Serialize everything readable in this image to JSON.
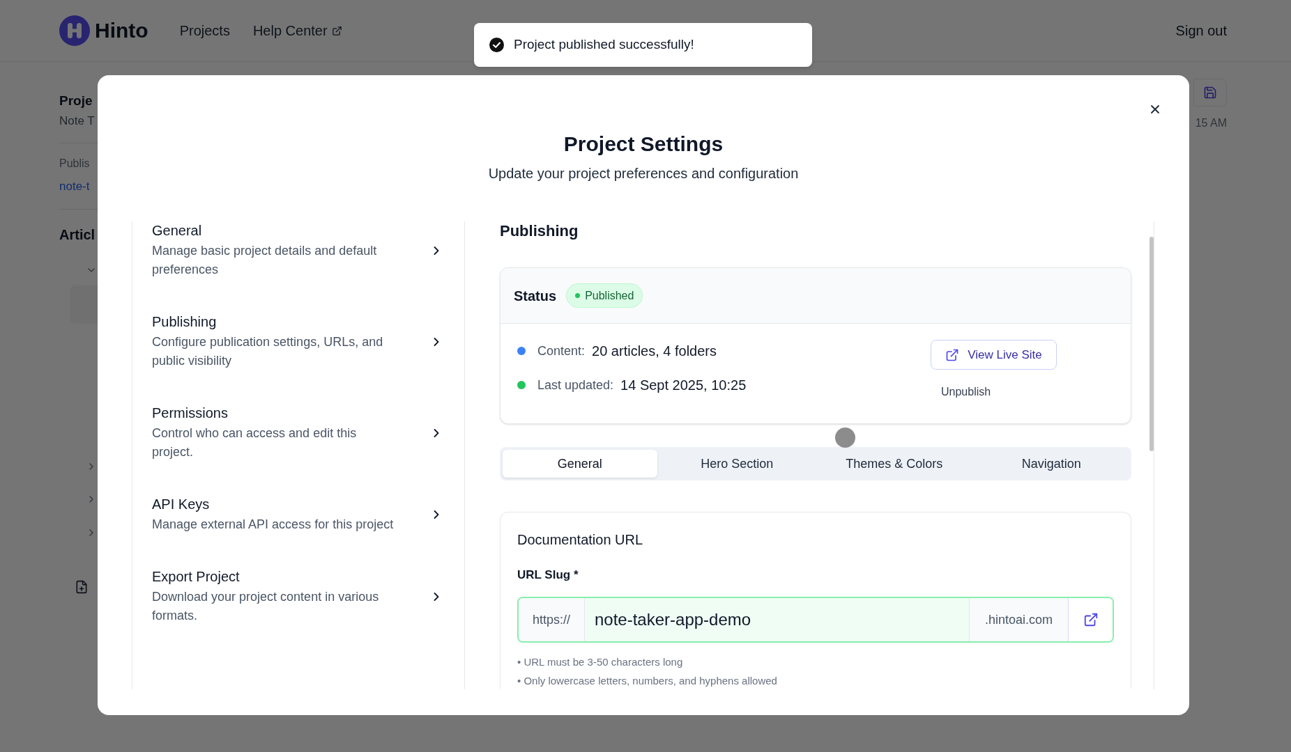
{
  "app_header": {
    "logo_text": "Hinto",
    "nav_links": [
      {
        "label": "Projects",
        "external": false
      },
      {
        "label": "Help Center",
        "external": true
      }
    ],
    "sign_out": "Sign out"
  },
  "toast": {
    "message": "Project published successfully!"
  },
  "background_page": {
    "project_title": "Proje",
    "project_subtitle": "Note T",
    "published_label": "Publis",
    "published_link": "note-t",
    "articles_heading": "Articl",
    "timestamp": "15 AM"
  },
  "modal": {
    "title": "Project Settings",
    "subtitle": "Update your project preferences and configuration",
    "sections": [
      {
        "title": "General",
        "description": "Manage basic project details and default preferences"
      },
      {
        "title": "Publishing",
        "description": "Configure publication settings, URLs, and public visibility"
      },
      {
        "title": "Permissions",
        "description": "Control who can access and edit this project."
      },
      {
        "title": "API Keys",
        "description": "Manage external API access for this project"
      },
      {
        "title": "Export Project",
        "description": "Download your project content in various formats."
      }
    ],
    "panel": {
      "heading": "Publishing",
      "status": {
        "label": "Status",
        "badge": "Published",
        "rows": [
          {
            "label": "Content:",
            "value": "20 articles, 4 folders",
            "color": "#3b82f6"
          },
          {
            "label": "Last updated:",
            "value": "14 Sept 2025, 10:25",
            "color": "#22c55e"
          }
        ],
        "view_button": "View Live Site",
        "unpublish_button": "Unpublish"
      },
      "tabs": [
        {
          "label": "General",
          "selected": true
        },
        {
          "label": "Hero Section",
          "selected": false
        },
        {
          "label": "Themes & Colors",
          "selected": false
        },
        {
          "label": "Navigation",
          "selected": false
        }
      ],
      "documentation_url": {
        "title": "Documentation URL",
        "field_label": "URL Slug *",
        "prefix": "https://",
        "value": "note-taker-app-demo",
        "suffix": ".hintoai.com",
        "hints": [
          "• URL must be 3-50 characters long",
          "• Only lowercase letters, numbers, and hyphens allowed"
        ]
      }
    }
  }
}
